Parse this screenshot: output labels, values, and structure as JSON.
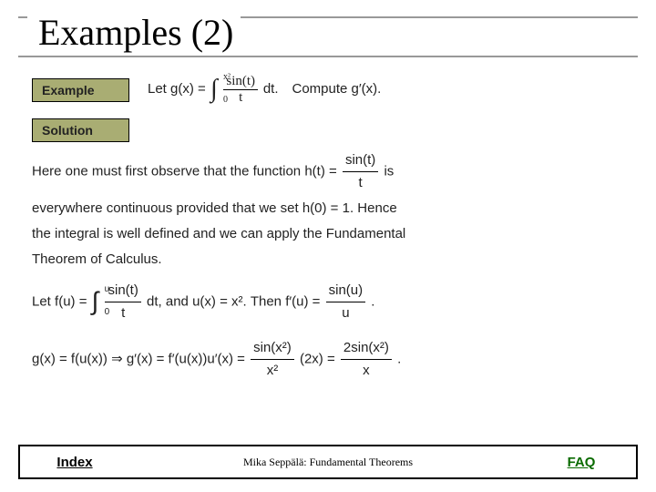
{
  "title": "Examples (2)",
  "labels": {
    "example": "Example",
    "solution": "Solution"
  },
  "problem": {
    "prefix": "Let  ",
    "gx": "g(x) = ",
    "integral_upper": "x²",
    "integral_lower": "0",
    "integrand_num": "sin(t)",
    "integrand_den": "t",
    "dt": "dt.",
    "compute": "Compute  g′(x)."
  },
  "solution": {
    "s1a": "Here one must first observe that the function  ",
    "s1b_h": "h(t) = ",
    "s1b_num": "sin(t)",
    "s1b_den": "t",
    "s1c": "  is",
    "s2a": "everywhere continuous provided that we set  ",
    "s2b": "h(0) = 1.",
    "s2c": "  Hence",
    "s3": "the integral is well defined and we can apply the Fundamental",
    "s4": "Theorem of Calculus.",
    "s5_let": "Let  ",
    "s5_f": "f(u) = ",
    "s5_iu": "u",
    "s5_il": "0",
    "s5_num": "sin(t)",
    "s5_den": "t",
    "s5_dt": "dt,",
    "s5_and": "  and  ",
    "s5_ux": "u(x) = x².",
    "s5_then": "  Then  ",
    "s5_fp": "f′(u) = ",
    "s5_fp_num": "sin(u)",
    "s5_fp_den": "u",
    "s5_dot": ".",
    "s6_g": "g(x) = f(u(x)) ⇒ g′(x) = f′(u(x))u′(x) = ",
    "s6_n1": "sin(x²)",
    "s6_d1": "x²",
    "s6_mid": "(2x) = ",
    "s6_n2": "2sin(x²)",
    "s6_d2": "x",
    "s6_dot": "."
  },
  "footer": {
    "index": "Index",
    "author": "Mika Seppälä: Fundamental Theorems",
    "faq": "FAQ"
  }
}
